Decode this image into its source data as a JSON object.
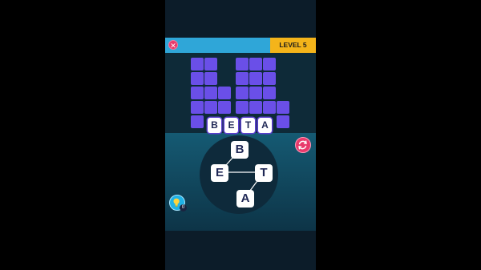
{
  "header": {
    "close_icon": "close-icon",
    "close_color": "#e8396b",
    "level_label": "LEVEL 5",
    "bar_color": "#2fa6d8",
    "level_color": "#f4b41a"
  },
  "board": {
    "tile_color": "#6a4fe8",
    "current_word": [
      "B",
      "E",
      "T",
      "A"
    ]
  },
  "wheel": {
    "letters": [
      "B",
      "E",
      "T",
      "A"
    ]
  },
  "controls": {
    "shuffle_icon": "shuffle-icon",
    "hint_icon": "lightbulb-icon",
    "hint_count": "0"
  }
}
